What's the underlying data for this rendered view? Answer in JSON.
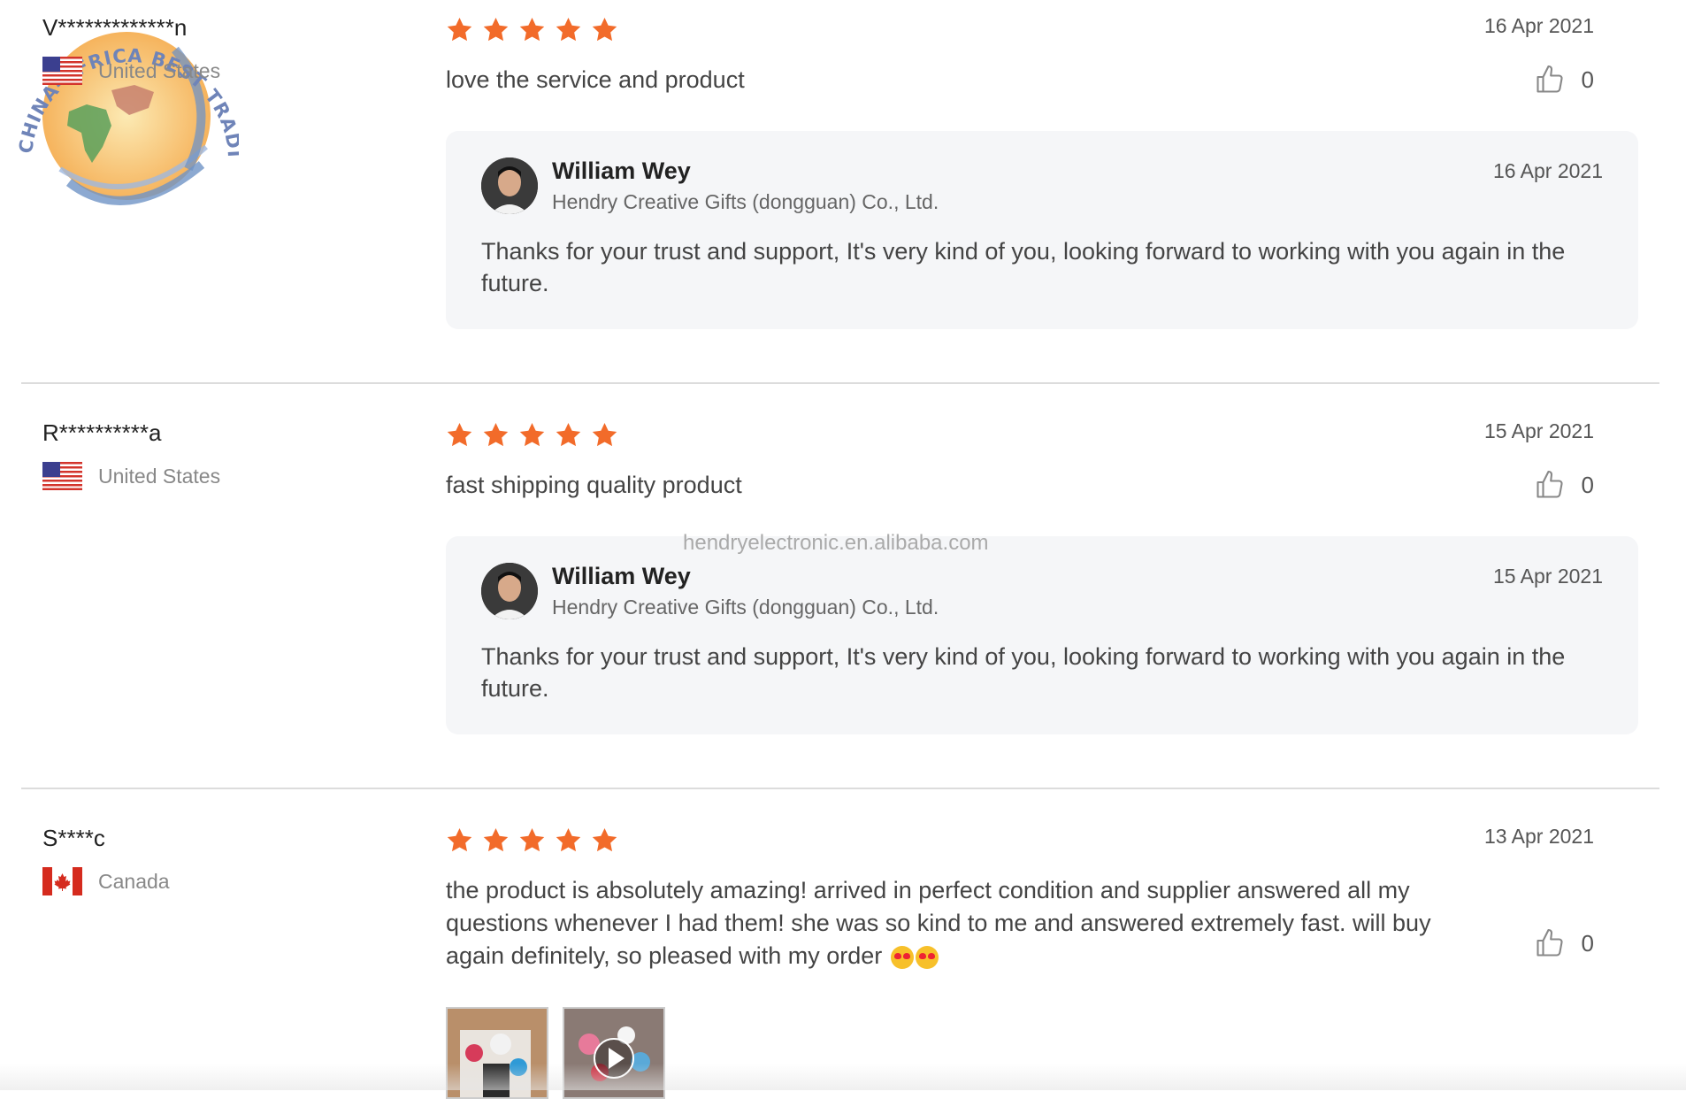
{
  "watermark": {
    "seal_text": "CHINA-AFRICA BEST TRADING PLATFORM",
    "url": "hendryelectronic.en.alibaba.com"
  },
  "colors": {
    "star": "#f26b2a",
    "reply_bg": "#f5f6f8",
    "divider": "#dcdcdc"
  },
  "reviews": [
    {
      "buyer": "V*************n",
      "country": "United States",
      "flag_icon": "us-flag-icon",
      "rating": 5,
      "date": "16 Apr 2021",
      "text": "love the service and product",
      "likes": "0",
      "reply": {
        "name": "William Wey",
        "company": "Hendry Creative Gifts (dongguan) Co., Ltd.",
        "date": "16 Apr 2021",
        "text": "Thanks for your trust and support, It's very kind of you, looking forward to working with you again in the future."
      }
    },
    {
      "buyer": "R**********a",
      "country": "United States",
      "flag_icon": "us-flag-icon",
      "rating": 5,
      "date": "15 Apr 2021",
      "text": "fast shipping quality product",
      "likes": "0",
      "reply": {
        "name": "William Wey",
        "company": "Hendry Creative Gifts (dongguan) Co., Ltd.",
        "date": "15 Apr 2021",
        "text": "Thanks for your trust and support, It's very kind of you, looking forward to working with you again in the future."
      }
    },
    {
      "buyer": "S****c",
      "country": "Canada",
      "flag_icon": "canada-flag-icon",
      "rating": 5,
      "date": "13 Apr 2021",
      "text": "the product is absolutely amazing! arrived in perfect condition and supplier answered all my questions whenever I had them! she was so kind to me and answered extremely fast. will buy again definitely, so pleased with my order",
      "likes": "0",
      "media": [
        "photo",
        "video"
      ]
    }
  ]
}
